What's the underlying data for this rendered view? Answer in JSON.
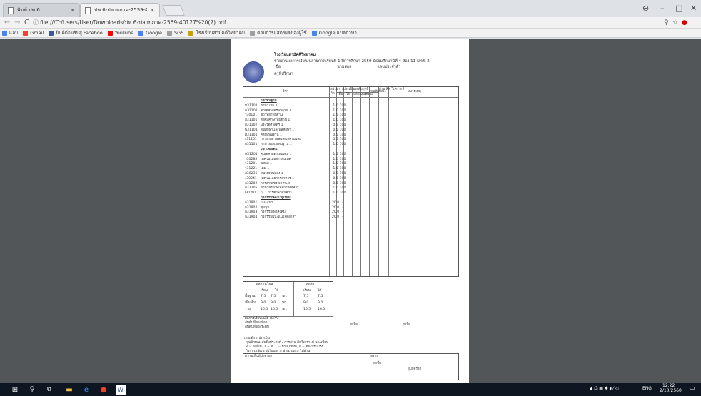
{
  "tabs": [
    {
      "label": "พิมพ์ ปพ.6",
      "active": false
    },
    {
      "label": "ปพ.6-ปลายภาค-2559-401",
      "active": true
    }
  ],
  "address": {
    "url": "file:///C:/Users/User/Downloads/ปพ.6-ปลายภาค-2559-40127%20(2).pdf"
  },
  "bookmarks": [
    {
      "label": "แอป",
      "color": "#4285f4"
    },
    {
      "label": "Gmail",
      "color": "#ea4335"
    },
    {
      "label": "ยินดีต้อนรับสู่ Faceboo",
      "color": "#3b5998"
    },
    {
      "label": "YouTube",
      "color": "#ff0000"
    },
    {
      "label": "Google",
      "color": "#4285f4"
    },
    {
      "label": "SGS",
      "color": "#9e9e9e"
    },
    {
      "label": "โรงเรียนสามัคคีวิทยาคม",
      "color": "#c8a000"
    },
    {
      "label": "ตอบการแสดงผลของผู้ใช้",
      "color": "#9e9e9e"
    },
    {
      "label": "Google แปลภาษา",
      "color": "#4285f4"
    }
  ],
  "document": {
    "school_name": "โรงเรียนสามัคคีวิทยาคม",
    "report_line": "รายงานผลการเรียน ปลายภาคเรียนที่ 1 ปีการศึกษา 2559 มัธยมศึกษาปีที่ 4 ห้อง 11 เลขที่ 2",
    "name_label": "ชื่อ",
    "surname": "นามสกุล",
    "id_label": "เลขประจำตัว",
    "teacher_label": "ครูที่ปรึกษา",
    "header": {
      "subject": "วิชา",
      "unit_top": "หน่วย",
      "unit_bottom": "กิต",
      "full": "เต็ม",
      "hours_top": "เวลา",
      "scores_label": "การประเมินผลสัมฤทธิ์",
      "got": "ได้",
      "final": "ปลายภาค",
      "ret": "แก้/ซ่อม",
      "attr": "คุณลักษณะ",
      "read": "อ่าน คิด วิเคราะห์",
      "remark": "หมายเหตุ"
    },
    "rows": [
      {
        "code": "",
        "name": "วิชาพื้นฐาน",
        "unit": "",
        "hrs": "",
        "group": true
      },
      {
        "code": "ท31101",
        "name": "ภาษาไทย 1",
        "unit": "1.0",
        "hrs": "100",
        "group": false
      },
      {
        "code": "ค31101",
        "name": "คณิตศาสตร์พื้นฐาน 1",
        "unit": "1.0",
        "hrs": "100",
        "group": false
      },
      {
        "code": "ว30101",
        "name": "ชีววิทยาพื้นฐาน",
        "unit": "1.5",
        "hrs": "100",
        "group": false
      },
      {
        "code": "ส31101",
        "name": "สังคมศึกษาพื้นฐาน 1",
        "unit": "1.0",
        "hrs": "100",
        "group": false
      },
      {
        "code": "ส31102",
        "name": "ประวัติศาสตร์ 1",
        "unit": "0.5",
        "hrs": "100",
        "group": false
      },
      {
        "code": "พ31101",
        "name": "สุขศึกษาและพลศึกษา 1",
        "unit": "0.5",
        "hrs": "100",
        "group": false
      },
      {
        "code": "ศ31101",
        "name": "ศิลปะพื้นฐาน 1",
        "unit": "0.5",
        "hrs": "100",
        "group": false
      },
      {
        "code": "ง31101",
        "name": "การงานอาชีพและเทคโนโลยี",
        "unit": "0.5",
        "hrs": "100",
        "group": false
      },
      {
        "code": "อ31101",
        "name": "ภาษาอังกฤษพื้นฐาน 1",
        "unit": "1.0",
        "hrs": "100",
        "group": false
      },
      {
        "code": "",
        "name": "วิชาเพิ่มเติม",
        "unit": "",
        "hrs": "",
        "group": true
      },
      {
        "code": "ค31201",
        "name": "คณิตศาสตร์เพิ่มเติม 1",
        "unit": "1.5",
        "hrs": "100",
        "group": false
      },
      {
        "code": "ว30285",
        "name": "เทคโนโลยีสารสนเทศ",
        "unit": "1.0",
        "hrs": "100",
        "group": false
      },
      {
        "code": "ว31201",
        "name": "ฟิสิกส์ 1",
        "unit": "1.5",
        "hrs": "100",
        "group": false
      },
      {
        "code": "ว31221",
        "name": "เคมี 1",
        "unit": "1.5",
        "hrs": "100",
        "group": false
      },
      {
        "code": "ส30231",
        "name": "หน้าที่พลเมือง 1",
        "unit": "0.5",
        "hrs": "100",
        "group": false
      },
      {
        "code": "ง30241",
        "name": "เทคโนโลยีการอาหาร 1",
        "unit": "0.5",
        "hrs": "100",
        "group": false
      },
      {
        "code": "อ31202",
        "name": "การอ่านเชิงวิเคราะห์",
        "unit": "0.5",
        "hrs": "100",
        "group": false
      },
      {
        "code": "ส31205",
        "name": "ภาษาอังกฤษเพื่อการสื่อสาร",
        "unit": "1.0",
        "hrs": "100",
        "group": false
      },
      {
        "code": "I30201",
        "name": "IS 1 การศึกษาค้นคว้า",
        "unit": "1.0",
        "hrs": "100",
        "group": false
      },
      {
        "code": "",
        "name": "กิจกรรมพัฒนาผู้เรียน",
        "unit": "",
        "hrs": "",
        "group": true
      },
      {
        "code": "ก31901",
        "name": "แนะแนว",
        "unit": "20.0",
        "hrs": "-",
        "group": false
      },
      {
        "code": "ก31902",
        "name": "ชุมนุม",
        "unit": "20.0",
        "hrs": "-",
        "group": false
      },
      {
        "code": "ก31903",
        "name": "กิจกรรมเพื่อสังคม",
        "unit": "20.0",
        "hrs": "-",
        "group": false
      },
      {
        "code": "ก31904",
        "name": "กิจกรรมแนะแนวจิตอาสา",
        "unit": "20.0",
        "hrs": "-",
        "group": false
      }
    ],
    "summary": {
      "title_left": "ผลการเรียน",
      "title_right": "สะสม",
      "col_reg": "เรียน",
      "col_got": "ได้",
      "rows": [
        {
          "label": "พื้นฐาน",
          "a": "7.5",
          "b": "7.5",
          "c": "นก.",
          "d": "7.5",
          "e": "7.5"
        },
        {
          "label": "เพิ่มเติม",
          "a": "9.0",
          "b": "9.0",
          "c": "นก.",
          "d": "9.0",
          "e": "9.0"
        },
        {
          "label": "รวม",
          "a": "16.5",
          "b": "16.5",
          "c": "นก.",
          "d": "16.5",
          "e": "16.5"
        }
      ],
      "gpa_label": "ผลการเรียนเฉลี่ย (GPA)",
      "rank_room": "อันดับที่ของห้อง",
      "rank_level": "อันดับที่ของระดับ",
      "legend_title": "เกณฑ์การประเมิน",
      "legend_1": "คุณลักษณะอันพึงประสงค์ / การอ่าน คิดวิเคราะห์ และเขียน",
      "legend_2": "3 = ดีเยี่ยม, 2 = ดี, 1 = ผ่านเกณฑ์, 0 = ต้องปรับปรุง",
      "legend_3": "กิจกรรมพัฒนาผู้เรียน ผ = ผ่าน, มผ = ไม่ผ่าน",
      "sign_1": "ลงชื่อ",
      "sign_2": "ลงชื่อ"
    },
    "parent": {
      "opinion": "ความเห็นผู้ปกครอง",
      "acknowledged": "ทราบ",
      "sign": "ลงชื่อ",
      "parent_label": "ผู้ปกครอง"
    }
  },
  "taskbar": {
    "lang": "ENG",
    "time": "12:22",
    "date": "2/10/2560"
  }
}
